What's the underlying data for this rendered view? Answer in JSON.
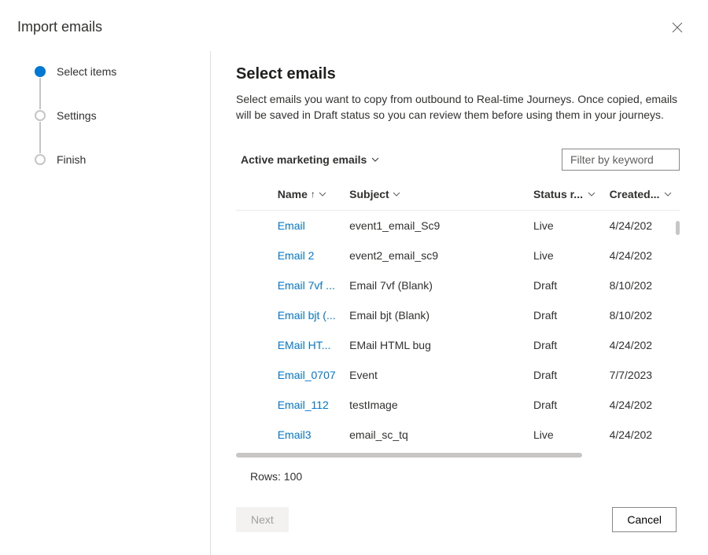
{
  "header": {
    "title": "Import emails"
  },
  "stepper": {
    "steps": [
      {
        "label": "Select items",
        "active": true
      },
      {
        "label": "Settings",
        "active": false
      },
      {
        "label": "Finish",
        "active": false
      }
    ]
  },
  "main": {
    "title": "Select emails",
    "description": "Select emails you want to copy from outbound to Real-time Journeys. Once copied, emails will be saved in Draft status so you can review them before using them in your journeys.",
    "view_label": "Active marketing emails",
    "filter_placeholder": "Filter by keyword"
  },
  "table": {
    "columns": {
      "name": "Name",
      "subject": "Subject",
      "status": "Status r...",
      "created": "Created..."
    },
    "rows": [
      {
        "name": "Email",
        "subject": "event1_email_Sc9",
        "status": "Live",
        "created": "4/24/202"
      },
      {
        "name": "Email 2",
        "subject": "event2_email_sc9",
        "status": "Live",
        "created": "4/24/202"
      },
      {
        "name": "Email 7vf ...",
        "subject": "Email 7vf (Blank)",
        "status": "Draft",
        "created": "8/10/202"
      },
      {
        "name": "Email bjt (...",
        "subject": "Email bjt (Blank)",
        "status": "Draft",
        "created": "8/10/202"
      },
      {
        "name": "EMail HT...",
        "subject": "EMail HTML bug",
        "status": "Draft",
        "created": "4/24/202"
      },
      {
        "name": "Email_0707",
        "subject": "Event",
        "status": "Draft",
        "created": "7/7/2023"
      },
      {
        "name": "Email_112",
        "subject": "testImage",
        "status": "Draft",
        "created": "4/24/202"
      },
      {
        "name": "Email3",
        "subject": "email_sc_tq",
        "status": "Live",
        "created": "4/24/202"
      }
    ],
    "rows_info": "Rows: 100"
  },
  "footer": {
    "next_label": "Next",
    "cancel_label": "Cancel"
  }
}
